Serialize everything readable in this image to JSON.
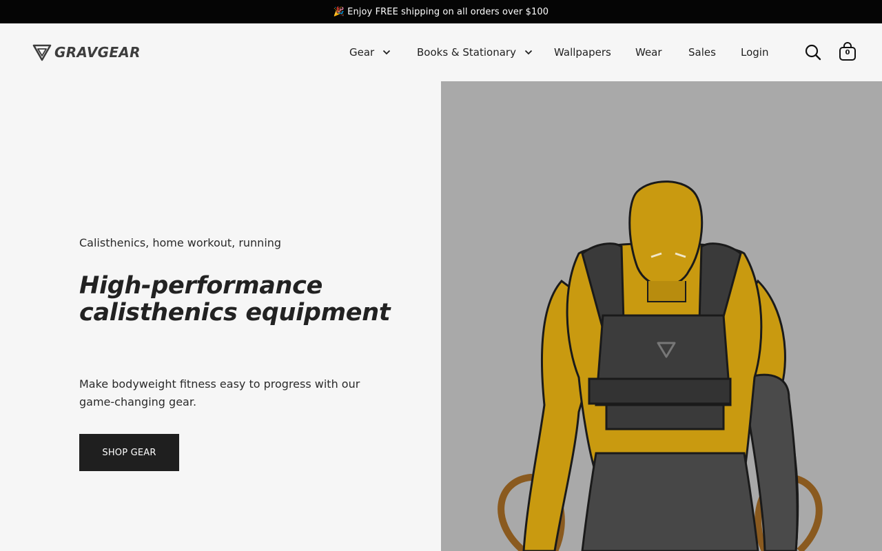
{
  "announcement": {
    "emoji": "🎉",
    "text": "Enjoy FREE shipping on all orders over $100"
  },
  "brand": {
    "name": "GRAVGEAR"
  },
  "nav": {
    "items": [
      {
        "label": "Gear",
        "has_dropdown": true
      },
      {
        "label": "Books & Stationary",
        "has_dropdown": true
      },
      {
        "label": "Wallpapers",
        "has_dropdown": false
      },
      {
        "label": "Wear",
        "has_dropdown": false
      },
      {
        "label": "Sales",
        "has_dropdown": false
      },
      {
        "label": "Login",
        "has_dropdown": false
      }
    ],
    "search_icon": "search-icon",
    "cart_icon": "shopping-bag-icon",
    "cart_count": "0"
  },
  "hero": {
    "eyebrow": "Calisthenics, home workout, running",
    "headline": "High-performance calisthenics equipment",
    "subtext": "Make bodyweight fitness easy to progress with our game-changing gear.",
    "cta_label": "SHOP GEAR"
  },
  "colors": {
    "announcement_bg": "#050505",
    "page_bg": "#f6f6f6",
    "cta_bg": "#1f1f1f",
    "hero_image_bg": "#a9a9a9",
    "figure_skin": "#c99a10",
    "vest": "#3a3a3a"
  }
}
